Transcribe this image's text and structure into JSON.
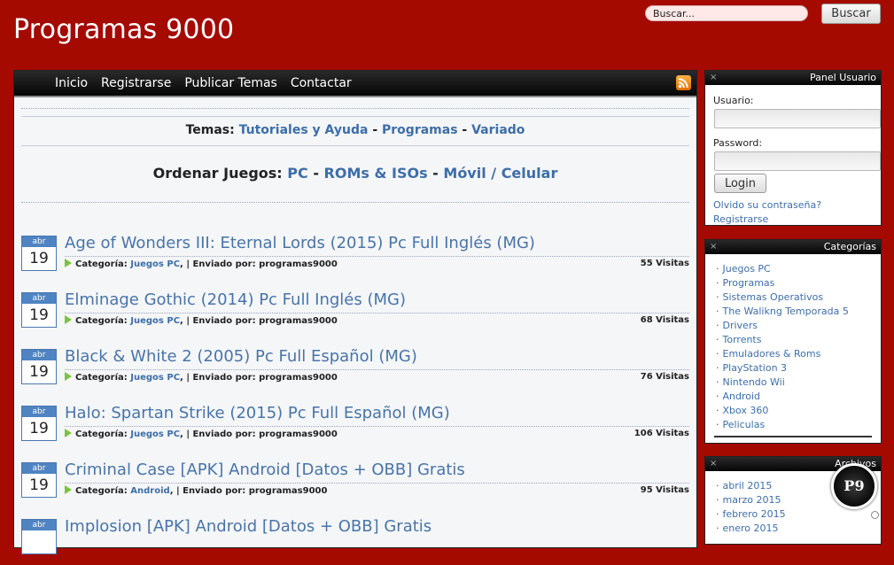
{
  "header": {
    "site_title": "Programas 9000",
    "search_placeholder": "Buscar...",
    "search_button": "Buscar"
  },
  "nav": {
    "items": [
      "Inicio",
      "Registrarse",
      "Publicar Temas",
      "Contactar"
    ],
    "rss_icon": "rss-icon"
  },
  "topics": {
    "label": "Temas:",
    "links": [
      "Tutoriales y Ayuda",
      "Programas",
      "Variado"
    ],
    "separator": "-"
  },
  "order": {
    "label": "Ordenar Juegos:",
    "links": [
      "PC",
      "ROMs & ISOs",
      "Móvil / Celular"
    ]
  },
  "post_labels": {
    "category": "Categoría:",
    "sent_by": "Enviado por:",
    "sep": ",  |"
  },
  "posts": [
    {
      "month": "abr",
      "day": "19",
      "title": "Age of Wonders III: Eternal Lords (2015) Pc Full Inglés (MG)",
      "category": "Juegos PC",
      "author": "programas9000",
      "visits": "55 Visitas"
    },
    {
      "month": "abr",
      "day": "19",
      "title": "Elminage Gothic (2014) Pc Full Inglés (MG)",
      "category": "Juegos PC",
      "author": "programas9000",
      "visits": "68 Visitas"
    },
    {
      "month": "abr",
      "day": "19",
      "title": "Black & White 2 (2005) Pc Full Español (MG)",
      "category": "Juegos PC",
      "author": "programas9000",
      "visits": "76 Visitas"
    },
    {
      "month": "abr",
      "day": "19",
      "title": "Halo: Spartan Strike (2015) Pc Full Español (MG)",
      "category": "Juegos PC",
      "author": "programas9000",
      "visits": "106 Visitas"
    },
    {
      "month": "abr",
      "day": "19",
      "title": "Criminal Case [APK] Android [Datos + OBB] Gratis",
      "category": "Android",
      "author": "programas9000",
      "visits": "95 Visitas"
    },
    {
      "month": "abr",
      "day": "",
      "title": "Implosion [APK] Android [Datos + OBB] Gratis",
      "category": "",
      "author": "",
      "visits": ""
    }
  ],
  "user_panel": {
    "title": "Panel Usuario",
    "close": "×",
    "username_label": "Usuario:",
    "password_label": "Password:",
    "login_button": "Login",
    "forgot_link": "Olvido su contraseña?",
    "register_link": "Registrarse"
  },
  "categories": {
    "title": "Categorías",
    "close": "×",
    "items": [
      "Juegos PC",
      "Programas",
      "Sistemas Operativos",
      "The Walikng Temporada 5",
      "Drivers",
      "Torrents",
      "Emuladores & Roms",
      "PlayStation 3",
      "Nintendo Wii",
      "Android",
      "Xbox 360",
      "Peliculas"
    ]
  },
  "archives": {
    "title": "Archivos",
    "close": "×",
    "items": [
      "abril 2015",
      "marzo 2015",
      "febrero 2015",
      "enero 2015"
    ]
  },
  "badge": {
    "text": "P9"
  }
}
